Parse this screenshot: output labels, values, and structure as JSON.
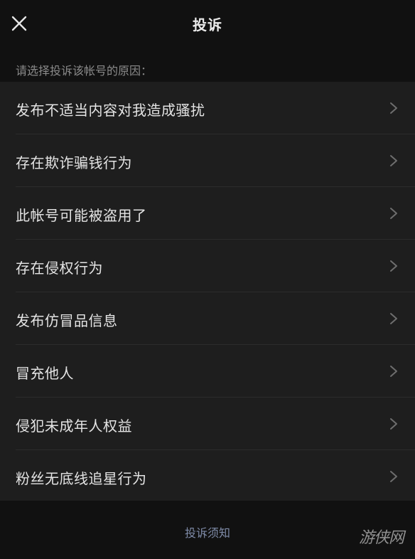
{
  "header": {
    "title": "投诉",
    "close_icon": "close-icon"
  },
  "hint": "请选择投诉该帐号的原因：",
  "reasons": [
    {
      "label": "发布不适当内容对我造成骚扰"
    },
    {
      "label": "存在欺诈骗钱行为"
    },
    {
      "label": "此帐号可能被盗用了"
    },
    {
      "label": "存在侵权行为"
    },
    {
      "label": "发布仿冒品信息"
    },
    {
      "label": "冒充他人"
    },
    {
      "label": "侵犯未成年人权益"
    },
    {
      "label": "粉丝无底线追星行为"
    }
  ],
  "footer": {
    "notice_link": "投诉须知",
    "watermark": "游侠网"
  },
  "colors": {
    "background": "#111111",
    "list_background": "#1e1e1e",
    "link": "#7f8ba8",
    "hint_text": "#8a8a8a"
  }
}
